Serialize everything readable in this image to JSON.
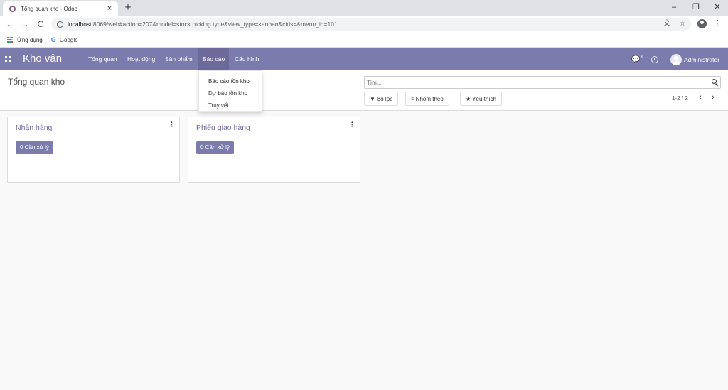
{
  "browser": {
    "tab_title": "Tổng quan kho - Odoo",
    "tab_close": "×",
    "new_tab": "+",
    "window_controls": {
      "minimize": "–",
      "restore": "❐",
      "close": "✕"
    },
    "nav": {
      "back": "←",
      "forward": "→",
      "reload": "C"
    },
    "url_host": "localhost",
    "url_rest": ":8069/web#action=207&model=stock.picking.type&view_type=kanban&cids=&menu_id=101",
    "info_icon": "i",
    "translate_icon": "文",
    "star_icon": "☆",
    "menu_icon": "⋮",
    "bookmarks": [
      {
        "label": "Ứng dụng",
        "icon": "apps-grid-icon"
      },
      {
        "label": "Google",
        "icon": "G"
      }
    ],
    "apps_grid_colors": [
      "#ea4335",
      "#fbbc05",
      "#34a853",
      "#4285f4",
      "#ea4335",
      "#fbbc05",
      "#34a853",
      "#4285f4",
      "#ea4335"
    ]
  },
  "navbar": {
    "brand": "Kho vận",
    "menu": [
      "Tổng quan",
      "Hoạt động",
      "Sản phẩm",
      "Báo cáo",
      "Cấu hình"
    ],
    "active_menu": "Báo cáo",
    "chat_icon": "💬",
    "chat_count": "3",
    "user_name": "Administrator",
    "color": "#7c7bad"
  },
  "dropdown": {
    "items": [
      "Báo cáo tồn kho",
      "Dự báo tồn kho",
      "Truy vết"
    ]
  },
  "control_panel": {
    "breadcrumb": "Tổng quan kho",
    "search_placeholder": "Tìm...",
    "filters_label": "Bộ lọc",
    "filters_icon": "▼",
    "groupby_label": "Nhóm theo",
    "groupby_icon": "≡",
    "favorites_label": "Yêu thích",
    "favorites_icon": "★",
    "pager": "1-2 / 2",
    "pager_prev": "‹",
    "pager_next": "›"
  },
  "kanban": {
    "cards": [
      {
        "title": "Nhận hàng",
        "button": "0 Cần xử lý",
        "menu_icon": "⋮"
      },
      {
        "title": "Phiếu giao hàng",
        "button": "0 Cần xử lý",
        "menu_icon": "⋮"
      }
    ]
  }
}
